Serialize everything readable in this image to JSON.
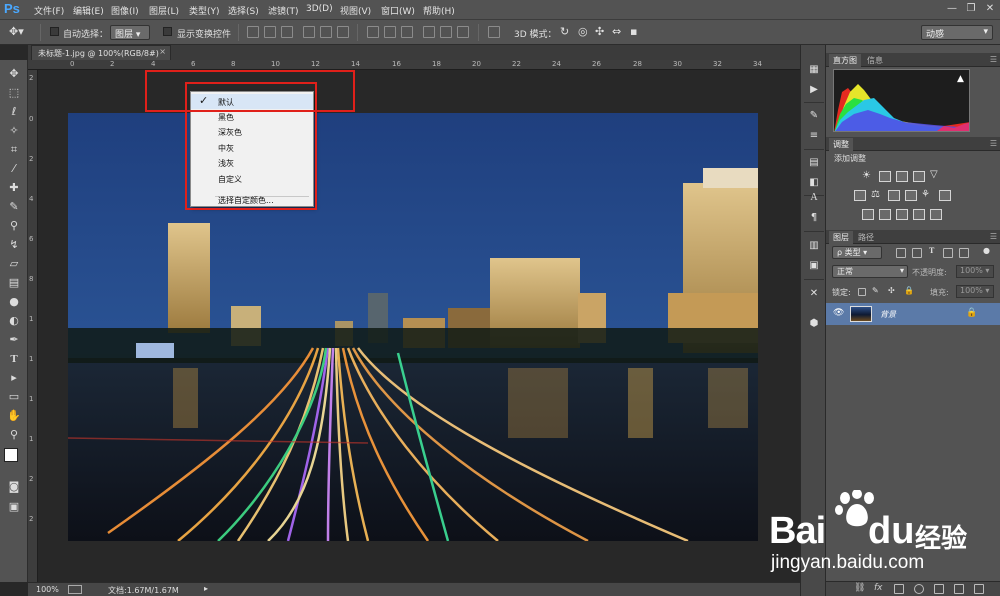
{
  "app": {
    "logo": "Ps"
  },
  "menu": [
    "文件(F)",
    "编辑(E)",
    "图像(I)",
    "图层(L)",
    "类型(Y)",
    "选择(S)",
    "滤镜(T)",
    "3D(D)",
    "视图(V)",
    "窗口(W)",
    "帮助(H)"
  ],
  "window_controls": {
    "minimize": "—",
    "restore": "❐",
    "close": "✕"
  },
  "options_bar": {
    "auto_select_label": "自动选择：",
    "auto_select_value": "图层",
    "show_transform_label": "显示变换控件",
    "mode_3d_label": "3D 模式：",
    "workspace_value": "动感"
  },
  "document": {
    "tab_title": "未标题-1.jpg @ 100%(RGB/8#)",
    "tab_close": "×",
    "zoom": "100%",
    "doc_info": "文档:1.67M/1.67M"
  },
  "ruler": {
    "top": [
      "0",
      "2",
      "4",
      "6",
      "8",
      "10",
      "12",
      "14",
      "16",
      "18",
      "20",
      "22",
      "24",
      "26",
      "28",
      "30",
      "32",
      "34"
    ],
    "left": [
      "2",
      "0",
      "2",
      "4",
      "6",
      "8",
      "1",
      "1",
      "1",
      "1",
      "2",
      "2"
    ]
  },
  "context_menu": {
    "check": "✓",
    "items": [
      "默认",
      "黑色",
      "深灰色",
      "中灰",
      "浅灰",
      "自定义",
      "选择自定颜色..."
    ],
    "selected_index": 0
  },
  "panels": {
    "histogram_tabs": [
      "直方图",
      "信息"
    ],
    "histogram_warning": "▲",
    "adjustments_tab": "调整",
    "adjustments_title": "添加调整",
    "layers_tabs": [
      "图层",
      "路径"
    ],
    "layer_filter": "ρ 类型",
    "blend_mode": "正常",
    "opacity_label": "不透明度:",
    "opacity_value": "100%",
    "lock_label": "锁定:",
    "fill_label": "填充:",
    "fill_value": "100%",
    "layer_name": "背景",
    "layer_visible": "👁",
    "layer_lock": "🔒"
  },
  "watermark": {
    "bai": "Bai",
    "du": "du",
    "jingyan": "经验",
    "url": "jingyan.baidu.com"
  }
}
